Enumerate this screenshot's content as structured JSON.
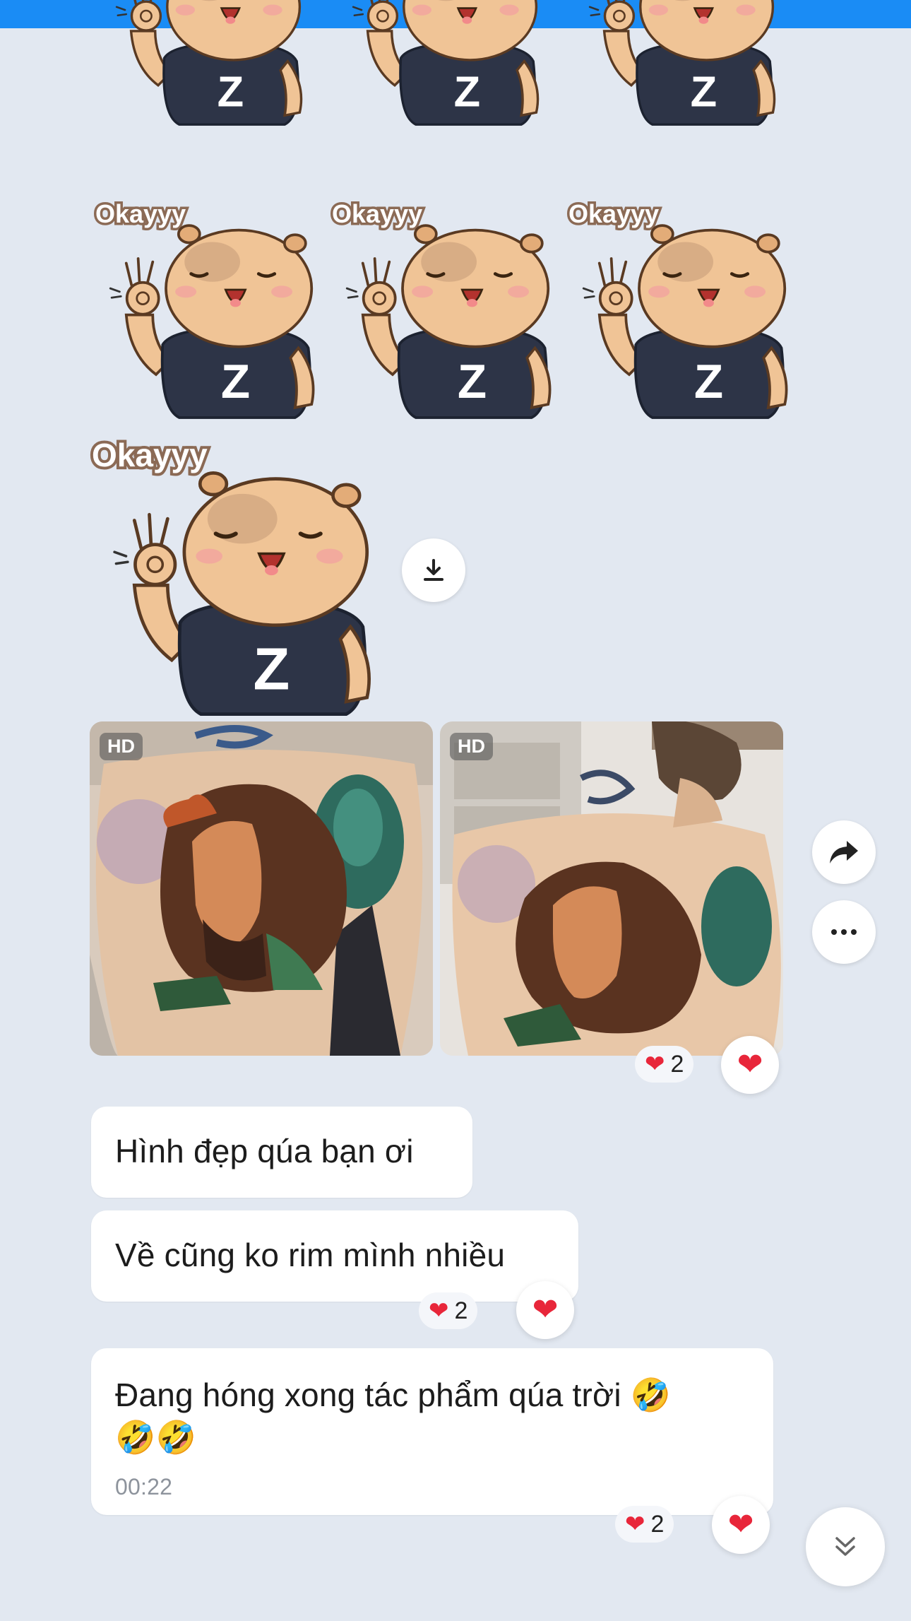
{
  "sticker": {
    "caption": "Okayyy",
    "shirt_letter": "Z",
    "icon": "capybara-ok-sticker"
  },
  "download_icon": "download-icon",
  "photos": [
    {
      "badge": "HD"
    },
    {
      "badge": "HD"
    }
  ],
  "actions": {
    "share_icon": "share-arrow-icon",
    "more_icon": "more-dots-icon"
  },
  "reactions": {
    "heart": "❤",
    "photo_count": "2",
    "message2_count": "2",
    "message3_count": "2"
  },
  "messages": [
    {
      "text": "Hình đẹp qúa bạn ơi"
    },
    {
      "text": "Về cũng ko rim mình nhiều"
    },
    {
      "text": "Đang hóng xong tác phẩm qúa trời 🤣\n🤣🤣",
      "time": "00:22"
    }
  ],
  "colors": {
    "header": "#1a8cf5",
    "background": "#e2e8f1",
    "heart": "#e8263a",
    "shirt": "#2d3447",
    "fur": "#f0c496"
  }
}
